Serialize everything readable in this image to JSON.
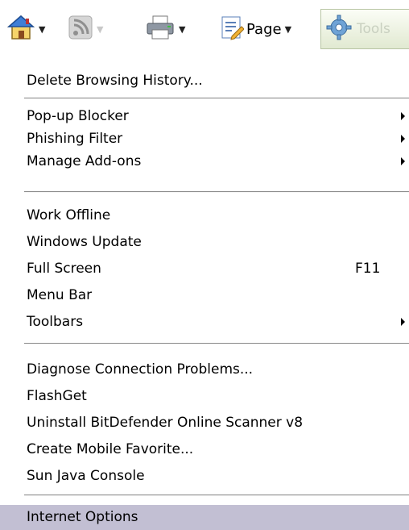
{
  "toolbar": {
    "home_icon": "home-icon",
    "feeds_icon": "feeds-icon",
    "print_icon": "print-icon",
    "page_icon": "page-icon",
    "tools_icon": "gear-icon",
    "page_label": "Page",
    "tools_label": "Tools",
    "dropdown_arrow": "▼"
  },
  "menu": {
    "delete_history": "Delete Browsing History...",
    "popup_blocker": "Pop-up Blocker",
    "phishing_filter": "Phishing Filter",
    "manage_addons": "Manage Add-ons",
    "work_offline": "Work Offline",
    "windows_update": "Windows Update",
    "full_screen": "Full Screen",
    "full_screen_shortcut": "F11",
    "menu_bar": "Menu Bar",
    "toolbars": "Toolbars",
    "diagnose": "Diagnose Connection Problems...",
    "flashget": "FlashGet",
    "uninstall_bitdefender": "Uninstall BitDefender Online Scanner v8",
    "create_mobile_favorite": "Create Mobile Favorite...",
    "sun_java_console": "Sun Java Console",
    "internet_options": "Internet Options"
  },
  "colors": {
    "highlight": "#c2bfd3",
    "tools_button_bg": "#e1e9d1"
  }
}
